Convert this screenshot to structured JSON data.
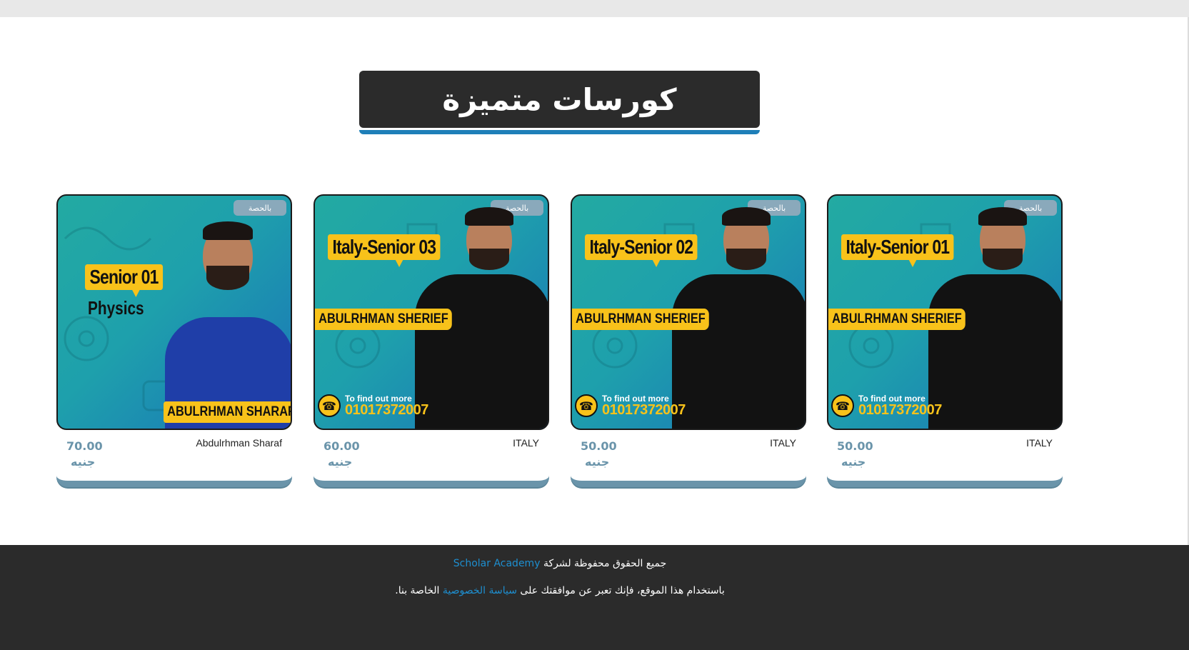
{
  "heading": {
    "title": "كورسات متميزة"
  },
  "courses": [
    {
      "badge": "بالحصة",
      "title_tag": "Italy-Senior 01",
      "name_band": "ABULRHMAN SHERIEF",
      "contact_small": "To find out more",
      "contact_phone": "01017372007",
      "price": "50.00",
      "currency": "جنيه",
      "teacher": "ITALY"
    },
    {
      "badge": "بالحصة",
      "title_tag": "Italy-Senior 02",
      "name_band": "ABULRHMAN SHERIEF",
      "contact_small": "To find out more",
      "contact_phone": "01017372007",
      "price": "50.00",
      "currency": "جنيه",
      "teacher": "ITALY"
    },
    {
      "badge": "بالحصة",
      "title_tag": "Italy-Senior 03",
      "name_band": "ABULRHMAN SHERIEF",
      "contact_small": "To find out more",
      "contact_phone": "01017372007",
      "price": "60.00",
      "currency": "جنيه",
      "teacher": "ITALY"
    },
    {
      "badge": "بالحصة",
      "title_tag": "Senior 01",
      "subtitle_tag": "Physics",
      "name_band": "ABULRHMAN SHARAF",
      "price": "70.00",
      "currency": "جنيه",
      "teacher": "Abdulrhman Sharaf"
    }
  ],
  "footer": {
    "rights_text": "جميع الحقوق محفوظة لشركة",
    "company_link": "Scholar Academy",
    "privacy_prefix": "باستخدام هذا الموقع، فإنك تعبر عن موافقتك على",
    "privacy_link": "سياسة الخصوصية",
    "privacy_suffix": "الخاصة بنا."
  },
  "colors": {
    "heading_bg": "#2b2b2b",
    "accent_blue": "#1e7fb8",
    "price_color": "#6a94aa",
    "tag_yellow": "#f8c21a",
    "footer_bg": "#2b2b2b",
    "link_color": "#1e8fd0"
  }
}
